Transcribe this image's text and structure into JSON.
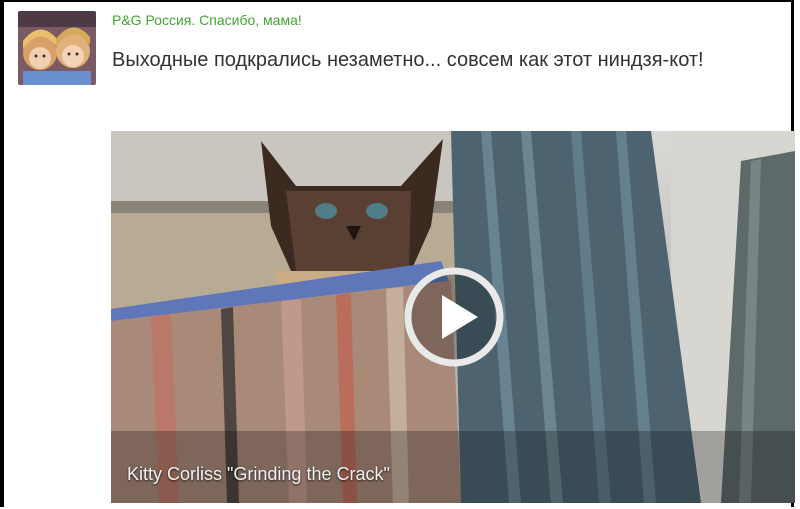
{
  "post": {
    "author": "P&G Россия. Спасибо, мама!",
    "text": "Выходные подкрались незаметно... совсем как этот ниндзя-кот!"
  },
  "video": {
    "caption": "Kitty Corliss \"Grinding the Crack\"",
    "play_icon": "play-icon"
  },
  "colors": {
    "author_link": "#3fa82f",
    "text": "#333333"
  }
}
